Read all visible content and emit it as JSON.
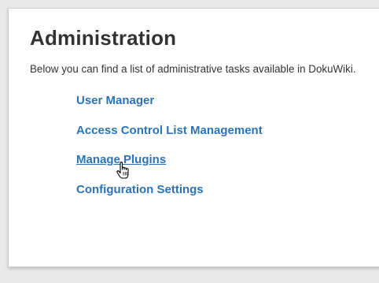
{
  "page": {
    "title": "Administration",
    "intro": "Below you can find a list of administrative tasks available in DokuWiki."
  },
  "admin_tasks": [
    {
      "label": "User Manager"
    },
    {
      "label": "Access Control List Management"
    },
    {
      "label": "Manage Plugins",
      "hovered": true
    },
    {
      "label": "Configuration Settings"
    }
  ],
  "colors": {
    "link": "#2b73b7",
    "text": "#333333",
    "background": "#e9e9e9",
    "panel": "#ffffff"
  },
  "cursor": {
    "icon": "hand-pointer-icon"
  }
}
